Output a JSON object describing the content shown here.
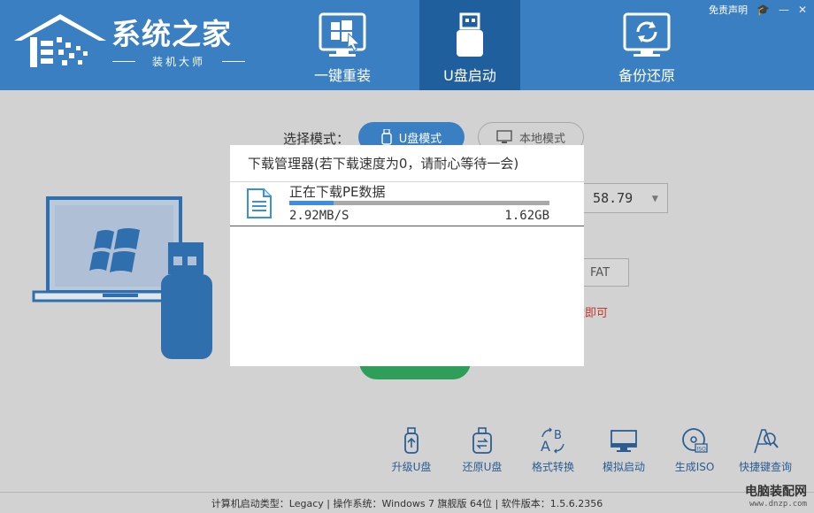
{
  "header": {
    "logo_title": "系统之家",
    "logo_subtitle": "装机大师",
    "tabs": [
      {
        "label": "一键重装",
        "icon": "windows-install-icon",
        "active": false
      },
      {
        "label": "U盘启动",
        "icon": "usb-drive-icon",
        "active": true
      },
      {
        "label": "备份还原",
        "icon": "backup-restore-icon",
        "active": false
      }
    ],
    "top_links": {
      "disclaimer": "免责声明",
      "icons": [
        "graduation-cap-icon",
        "minimize-icon",
        "close-icon"
      ]
    }
  },
  "mode": {
    "label": "选择模式：",
    "u_mode": "U盘模式",
    "local_mode": "本地模式"
  },
  "background": {
    "drive_select": ") 58.79",
    "format": "FAT",
    "red_hint": "盘即可"
  },
  "dialog": {
    "title": "下载管理器(若下载速度为0，请耐心等待一会)",
    "item": {
      "name": "正在下载PE数据",
      "speed": "2.92MB/S",
      "size": "1.62GB",
      "progress": 0.17
    }
  },
  "tools": [
    {
      "label": "升级U盘",
      "icon": "upgrade-usb-icon"
    },
    {
      "label": "还原U盘",
      "icon": "restore-usb-icon"
    },
    {
      "label": "格式转换",
      "icon": "format-convert-icon"
    },
    {
      "label": "模拟启动",
      "icon": "simulate-boot-icon"
    },
    {
      "label": "生成ISO",
      "icon": "make-iso-icon"
    },
    {
      "label": "快捷键查询",
      "icon": "shortcut-query-icon"
    }
  ],
  "statusbar": "计算机启动类型：Legacy | 操作系统：Windows 7 旗舰版 64位 | 软件版本：1.5.6.2356",
  "watermark": {
    "main": "电脑装配网",
    "sub": "www.dnzp.com"
  },
  "colors": {
    "header_blue": "#3a7fc1",
    "active_tab": "#1f5f9e",
    "tool_text": "#2b5d92",
    "progress": "#3a8ee6",
    "start_green": "#2e9e5a"
  }
}
